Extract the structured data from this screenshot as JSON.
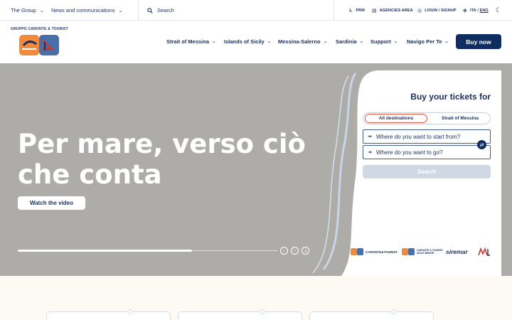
{
  "topbar": {
    "group_menu": "The Group",
    "news_menu": "News and communications",
    "search_placeholder": "Search",
    "prm": "PRM",
    "agencies": "AGENCIES AREA",
    "login": "LOGIN / SIGNUP",
    "lang_ita": "ITA",
    "lang_sep": " / ",
    "lang_eng": "ENG"
  },
  "header": {
    "logo_caption": "GRUPPO CARONTE & TOURIST",
    "nav": [
      "Strait of Messina",
      "Islands of Sicily",
      "Messina-Salerno",
      "Sardinia",
      "Support",
      "Navigo Per Te"
    ],
    "buy_now": "Buy now"
  },
  "hero": {
    "title": "Per mare, verso ciò che conta",
    "watch_video": "Watch the video",
    "slide_progress": 0.67
  },
  "booking": {
    "title": "Buy your tickets for",
    "tabs": [
      "All destinations",
      "Strait of Messina"
    ],
    "active_tab": "All destinations",
    "from_placeholder": "Where do you want to start from?",
    "to_placeholder": "Where do you want to go?",
    "search": "Search"
  },
  "brands": {
    "caronte": "CARONTE&TOURIST",
    "isole_minori_line1": "CARONTE & TOURIST",
    "isole_minori_line2": "ISOLE MINORI",
    "siremar": "siremar"
  },
  "colors": {
    "brand_navy": "#0f2d60",
    "accent_orange": "#e0553a",
    "hero_bg": "#aeaca8",
    "cream": "#fcfaf3"
  },
  "icons": {
    "search": "search-icon",
    "theme": "moon-icon",
    "prm": "accessibility-icon",
    "agencies": "building-icon",
    "login": "user-icon",
    "lang": "globe-icon"
  }
}
